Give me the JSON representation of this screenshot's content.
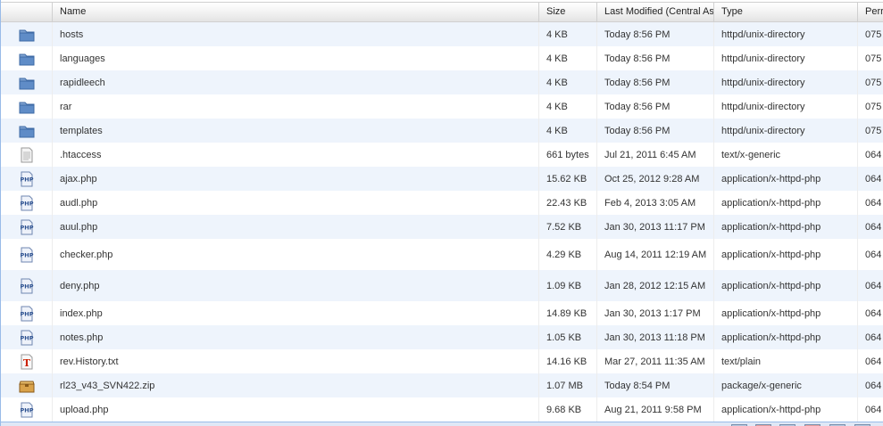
{
  "columns": [
    "Name",
    "Size",
    "Last Modified (Central As",
    "Type",
    "Perr"
  ],
  "rows": [
    {
      "icon": "folder-icon",
      "name": "hosts",
      "size": "4 KB",
      "modified": "Today 8:56 PM",
      "type": "httpd/unix-directory",
      "perm": "075"
    },
    {
      "icon": "folder-icon",
      "name": "languages",
      "size": "4 KB",
      "modified": "Today 8:56 PM",
      "type": "httpd/unix-directory",
      "perm": "075"
    },
    {
      "icon": "folder-icon",
      "name": "rapidleech",
      "size": "4 KB",
      "modified": "Today 8:56 PM",
      "type": "httpd/unix-directory",
      "perm": "075"
    },
    {
      "icon": "folder-icon",
      "name": "rar",
      "size": "4 KB",
      "modified": "Today 8:56 PM",
      "type": "httpd/unix-directory",
      "perm": "075"
    },
    {
      "icon": "folder-icon",
      "name": "templates",
      "size": "4 KB",
      "modified": "Today 8:56 PM",
      "type": "httpd/unix-directory",
      "perm": "075"
    },
    {
      "icon": "generic-file-icon",
      "name": ".htaccess",
      "size": "661 bytes",
      "modified": "Jul 21, 2011 6:45 AM",
      "type": "text/x-generic",
      "perm": "064"
    },
    {
      "icon": "php-file-icon",
      "name": "ajax.php",
      "size": "15.62 KB",
      "modified": "Oct 25, 2012 9:28 AM",
      "type": "application/x-httpd-php",
      "perm": "064"
    },
    {
      "icon": "php-file-icon",
      "name": "audl.php",
      "size": "22.43 KB",
      "modified": "Feb 4, 2013 3:05 AM",
      "type": "application/x-httpd-php",
      "perm": "064"
    },
    {
      "icon": "php-file-icon",
      "name": "auul.php",
      "size": "7.52 KB",
      "modified": "Jan 30, 2013 11:17 PM",
      "type": "application/x-httpd-php",
      "perm": "064"
    },
    {
      "icon": "php-file-icon",
      "name": "checker.php",
      "size": "4.29 KB",
      "modified": "Aug 14, 2011 12:19 AM",
      "type": "application/x-httpd-php",
      "perm": "064"
    },
    {
      "icon": "php-file-icon",
      "name": "deny.php",
      "size": "1.09 KB",
      "modified": "Jan 28, 2012 12:15 AM",
      "type": "application/x-httpd-php",
      "perm": "064"
    },
    {
      "icon": "php-file-icon",
      "name": "index.php",
      "size": "14.89 KB",
      "modified": "Jan 30, 2013 1:17 PM",
      "type": "application/x-httpd-php",
      "perm": "064"
    },
    {
      "icon": "php-file-icon",
      "name": "notes.php",
      "size": "1.05 KB",
      "modified": "Jan 30, 2013 11:18 PM",
      "type": "application/x-httpd-php",
      "perm": "064"
    },
    {
      "icon": "text-file-icon",
      "name": "rev.History.txt",
      "size": "14.16 KB",
      "modified": "Mar 27, 2011 11:35 AM",
      "type": "text/plain",
      "perm": "064"
    },
    {
      "icon": "package-icon",
      "name": "rl23_v43_SVN422.zip",
      "size": "1.07 MB",
      "modified": "Today 8:54 PM",
      "type": "package/x-generic",
      "perm": "064"
    },
    {
      "icon": "php-file-icon",
      "name": "upload.php",
      "size": "9.68 KB",
      "modified": "Aug 21, 2011 9:58 PM",
      "type": "application/x-httpd-php",
      "perm": "064"
    }
  ],
  "colors": {
    "alt_row": "#eef4fc",
    "folder": "#6d93c4",
    "php": "#2a4f8f",
    "text_icon": "#cc2200",
    "package": "#c8902e"
  }
}
